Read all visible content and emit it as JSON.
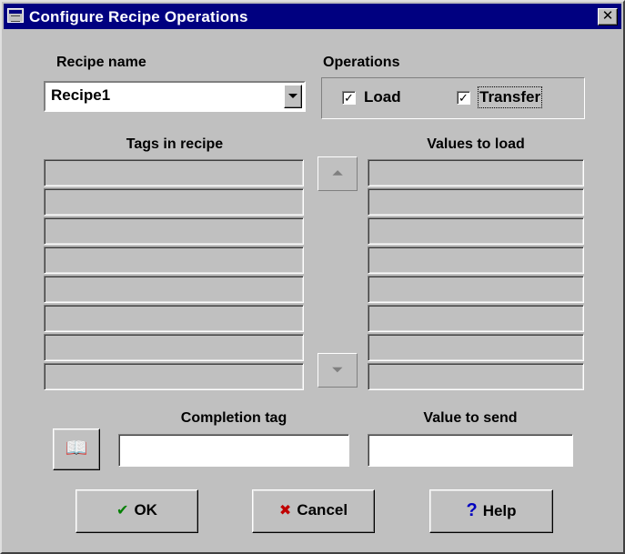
{
  "window": {
    "title": "Configure Recipe Operations",
    "close_glyph": "✕"
  },
  "recipe": {
    "label": "Recipe name",
    "value": "Recipe1"
  },
  "operations": {
    "label": "Operations",
    "load": {
      "label": "Load",
      "checked": true,
      "mark": "✓"
    },
    "transfer": {
      "label": "Transfer",
      "checked": true,
      "mark": "✓"
    }
  },
  "tags": {
    "label": "Tags in recipe",
    "rows": [
      "",
      "",
      "",
      "",
      "",
      "",
      "",
      ""
    ]
  },
  "values": {
    "label": "Values to load",
    "rows": [
      "",
      "",
      "",
      "",
      "",
      "",
      "",
      ""
    ]
  },
  "scroll": {
    "up_glyph": "⏶",
    "down_glyph": "⏷"
  },
  "completion": {
    "label": "Completion tag",
    "value": "",
    "browse_icon": "book-icon",
    "browse_glyph": "📖"
  },
  "send": {
    "label": "Value to send",
    "value": ""
  },
  "buttons": {
    "ok": {
      "label": "OK",
      "icon": "checkmark-icon",
      "glyph": "✔",
      "color": "#008000"
    },
    "cancel": {
      "label": "Cancel",
      "icon": "x-icon",
      "glyph": "✖",
      "color": "#c00000"
    },
    "help": {
      "label": "Help",
      "icon": "question-icon",
      "glyph": "?",
      "color": "#0000c0"
    }
  }
}
